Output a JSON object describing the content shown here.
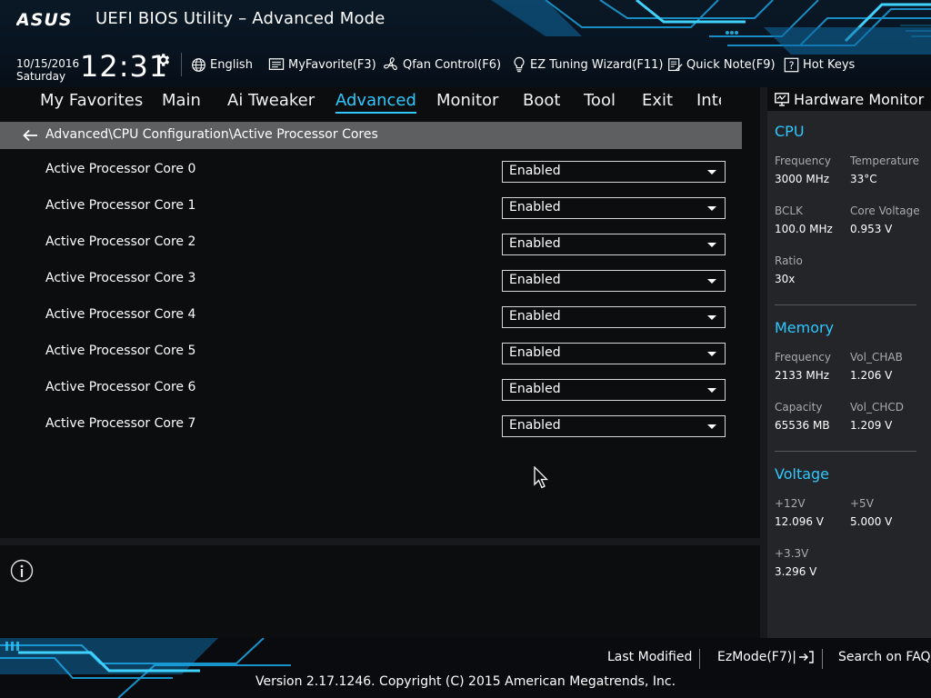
{
  "header": {
    "logo_text": "ASUS",
    "title": "UEFI BIOS Utility – Advanced Mode",
    "date": "10/15/2016",
    "day": "Saturday",
    "time": "12:31",
    "tools": [
      {
        "icon": "globe-icon",
        "label": "English"
      },
      {
        "icon": "favorite-list-icon",
        "label": "MyFavorite(F3)"
      },
      {
        "icon": "fan-icon",
        "label": "Qfan Control(F6)"
      },
      {
        "icon": "lightbulb-icon",
        "label": "EZ Tuning Wizard(F11)"
      },
      {
        "icon": "note-icon",
        "label": "Quick Note(F9)"
      },
      {
        "icon": "help-key-icon",
        "label": "Hot Keys"
      }
    ]
  },
  "nav": {
    "tabs": [
      {
        "label": "My Favorites",
        "active": false
      },
      {
        "label": "Main",
        "active": false
      },
      {
        "label": "Ai Tweaker",
        "active": false
      },
      {
        "label": "Advanced",
        "active": true
      },
      {
        "label": "Monitor",
        "active": false
      },
      {
        "label": "Boot",
        "active": false
      },
      {
        "label": "Tool",
        "active": false
      },
      {
        "label": "Exit",
        "active": false
      },
      {
        "label": "Inte",
        "active": false
      }
    ]
  },
  "main": {
    "breadcrumb": "Advanced\\CPU Configuration\\Active Processor Cores",
    "settings": [
      {
        "label": "Active Processor Core 0",
        "value": "Enabled"
      },
      {
        "label": "Active Processor Core 1",
        "value": "Enabled"
      },
      {
        "label": "Active Processor Core 2",
        "value": "Enabled"
      },
      {
        "label": "Active Processor Core 3",
        "value": "Enabled"
      },
      {
        "label": "Active Processor Core 4",
        "value": "Enabled"
      },
      {
        "label": "Active Processor Core 5",
        "value": "Enabled"
      },
      {
        "label": "Active Processor Core 6",
        "value": "Enabled"
      },
      {
        "label": "Active Processor Core 7",
        "value": "Enabled"
      }
    ]
  },
  "hardware_monitor": {
    "title": "Hardware Monitor",
    "cpu": {
      "heading": "CPU",
      "frequency_label": "Frequency",
      "frequency": "3000 MHz",
      "temperature_label": "Temperature",
      "temperature": "33°C",
      "bclk_label": "BCLK",
      "bclk": "100.0 MHz",
      "core_voltage_label": "Core Voltage",
      "core_voltage": "0.953 V",
      "ratio_label": "Ratio",
      "ratio": "30x"
    },
    "memory": {
      "heading": "Memory",
      "frequency_label": "Frequency",
      "frequency": "2133 MHz",
      "vol_chab_label": "Vol_CHAB",
      "vol_chab": "1.206 V",
      "capacity_label": "Capacity",
      "capacity": "65536 MB",
      "vol_chcd_label": "Vol_CHCD",
      "vol_chcd": "1.209 V"
    },
    "voltage": {
      "heading": "Voltage",
      "v12_label": "+12V",
      "v12": "12.096 V",
      "v5_label": "+5V",
      "v5": "5.000 V",
      "v33_label": "+3.3V",
      "v33": "3.296 V"
    }
  },
  "footer": {
    "last_modified": "Last Modified",
    "ezmode": "EzMode(F7)|",
    "search_faq": "Search on FAQ",
    "copyright": "Version 2.17.1246. Copyright (C) 2015 American Megatrends, Inc."
  },
  "colors": {
    "accent": "#2ec8ff",
    "panel_bg": "#0c0d0f",
    "monitor_bg": "#232528",
    "breadcrumb_bg": "#5e5f61"
  }
}
